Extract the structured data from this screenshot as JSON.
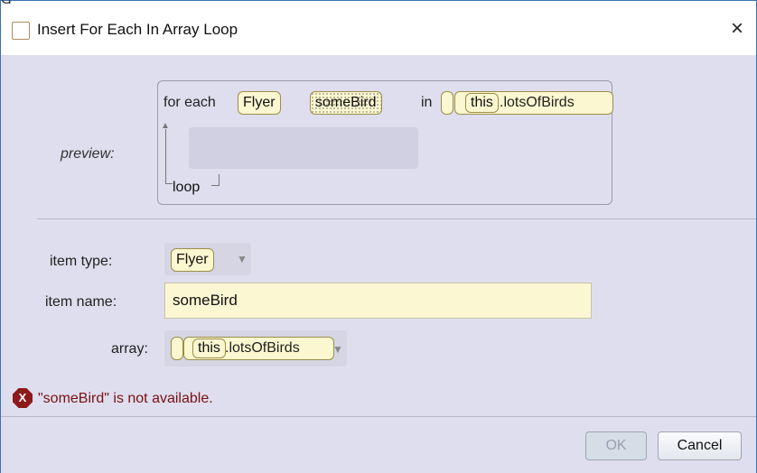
{
  "window": {
    "title": "Insert For Each In Array Loop",
    "close_glyph": "×"
  },
  "preview": {
    "label": "preview:",
    "for_each": "for each",
    "type": "Flyer",
    "item": "someBird",
    "in": "in",
    "this": "this",
    "array_suffix": ".lotsOfBirds",
    "loop": "loop"
  },
  "form": {
    "item_type_label": "item type:",
    "item_type_value": "Flyer",
    "item_name_label": "item name:",
    "item_name_value": "someBird",
    "array_label": "array:",
    "array_this": "this",
    "array_suffix": ".lotsOfBirds"
  },
  "error": {
    "icon": "x-icon",
    "glyph": "X",
    "message": "\"someBird\" is not available."
  },
  "buttons": {
    "ok": "OK",
    "cancel": "Cancel"
  }
}
